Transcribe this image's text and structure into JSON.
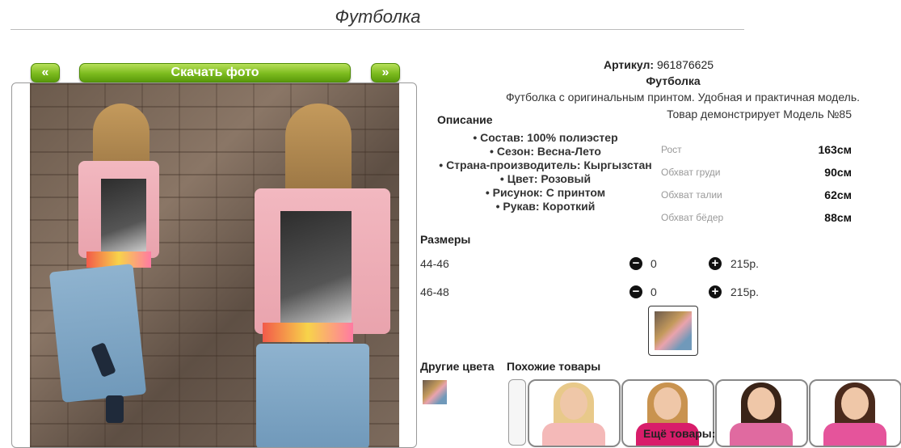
{
  "page": {
    "title": "Футболка"
  },
  "gallery": {
    "prev_label": "«",
    "download_label": "Скачать фото",
    "next_label": "»"
  },
  "product": {
    "sku_label": "Артикул:",
    "sku_value": "961876625",
    "name": "Футболка",
    "description": "Футболка с оригинальным принтом. Удобная и практичная модель.",
    "model_note": "Товар демонстрирует Модель №85",
    "specs_title": "Описание",
    "specs": [
      "Состав: 100% полиэстер",
      "Сезон: Весна-Лето",
      "Страна-производитель: Кыргызстан",
      "Цвет: Розовый",
      "Рисунок: С принтом",
      "Рукав: Короткий"
    ]
  },
  "measurements": [
    {
      "label": "Рост",
      "value": "163см"
    },
    {
      "label": "Обхват груди",
      "value": "90см"
    },
    {
      "label": "Обхват талии",
      "value": "62см"
    },
    {
      "label": "Обхват бёдер",
      "value": "88см"
    }
  ],
  "sizes": {
    "title": "Размеры",
    "rows": [
      {
        "size": "44-46",
        "qty": "0",
        "price": "215р."
      },
      {
        "size": "46-48",
        "qty": "0",
        "price": "215р."
      }
    ]
  },
  "other_colors_title": "Другие цвета",
  "similar_title": "Похожие товары",
  "more_title": "Ещё товары:",
  "similar_cards": [
    {
      "hair": "#e8c98a",
      "top": "#f4b9b8"
    },
    {
      "hair": "#c9934f",
      "top": "#d81d6a"
    },
    {
      "hair": "#3a2418",
      "top": "#e06aa0"
    },
    {
      "hair": "#4a2a1c",
      "top": "#e5549b"
    }
  ],
  "colors": {
    "button_green": "#7cbb1e",
    "shirt_pink": "#f2b8c0"
  }
}
